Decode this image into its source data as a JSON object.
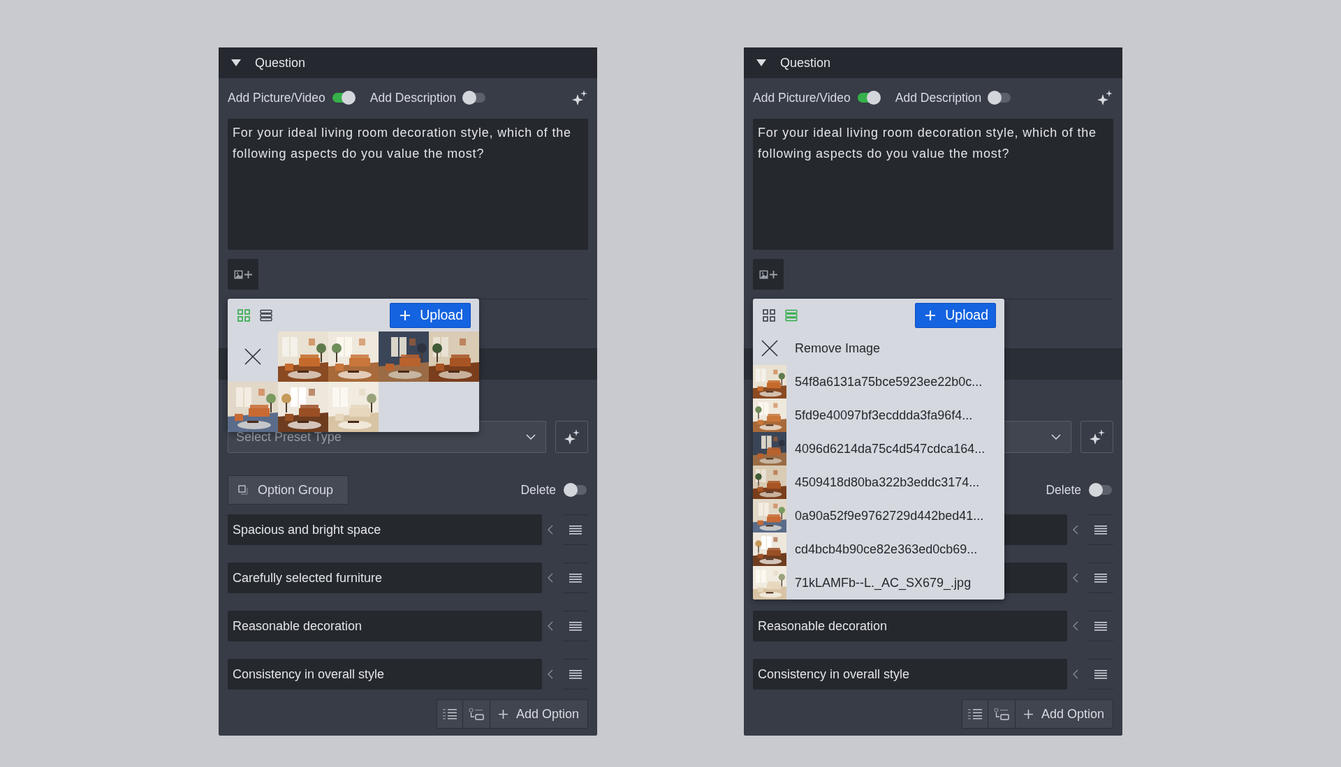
{
  "panels": [
    {
      "title": "Question",
      "expanded": true,
      "toggles": [
        {
          "label": "Add Picture/Video",
          "on": true
        },
        {
          "label": "Add Description",
          "on": false
        }
      ],
      "question_text": "For your ideal living room decoration style, which of the following aspects do you value the most?",
      "media_popup": {
        "view_buttons": [
          {
            "kind": "grid",
            "selected": true
          },
          {
            "kind": "list",
            "selected": false
          }
        ],
        "upload_label": "Upload"
      },
      "preset_select": {
        "placeholder": "Select Preset Type"
      },
      "option_group_label": "Option Group",
      "delete_toggle": {
        "label": "Delete",
        "on": false
      },
      "options": [
        {
          "text": "Spacious and bright space"
        },
        {
          "text": "Carefully selected furniture"
        },
        {
          "text": "Reasonable decoration"
        },
        {
          "text": "Consistency in overall style"
        }
      ],
      "add_option_label": "Add Option"
    },
    {
      "title": "Question",
      "expanded": true,
      "toggles": [
        {
          "label": "Add Picture/Video",
          "on": true
        },
        {
          "label": "Add Description",
          "on": false
        }
      ],
      "question_text": "For your ideal living room decoration style, which of the following aspects do you value the most?",
      "media_popup": {
        "view_buttons": [
          {
            "kind": "grid",
            "selected": false
          },
          {
            "kind": "list",
            "selected": true
          }
        ],
        "upload_label": "Upload",
        "remove_label": "Remove Image",
        "images": [
          {
            "file_name": "54f8a6131a75bce5923ee22b0c..."
          },
          {
            "file_name": "5fd9e40097bf3ecddda3fa96f4..."
          },
          {
            "file_name": "4096d6214da75c4d547cdca164..."
          },
          {
            "file_name": "4509418d80ba322b3eddc3174..."
          },
          {
            "file_name": "0a90a52f9e9762729d442bed41..."
          },
          {
            "file_name": "cd4bcb4b90ce82e363ed0cb69..."
          },
          {
            "file_name": "71kLAMFb--L._AC_SX679_.jpg"
          }
        ]
      },
      "delete_toggle": {
        "label": "Delete",
        "on": false
      },
      "options": [
        {
          "covered": true
        },
        {
          "covered": true
        },
        {
          "text": "Reasonable decoration"
        },
        {
          "text": "Consistency in overall style"
        }
      ],
      "add_option_label": "Add Option"
    }
  ]
}
